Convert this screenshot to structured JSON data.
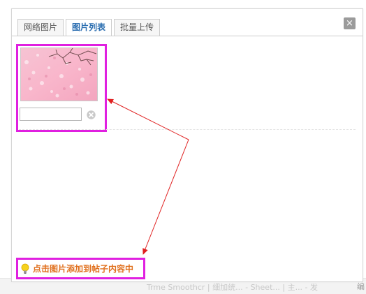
{
  "tabs": [
    {
      "label": "网络图片"
    },
    {
      "label": "图片列表"
    },
    {
      "label": "批量上传"
    }
  ],
  "active_tab": "图片列表",
  "close_label": "×",
  "images": [
    {
      "description_value": ""
    }
  ],
  "tip": {
    "text": "点击图片添加到帖子内容中",
    "icon": "lightbulb-icon"
  },
  "colors": {
    "annotation_box": "#e020e0",
    "annotation_arrow": "#e02020",
    "tip_text": "#e0701e",
    "active_tab_text": "#2a6db0"
  },
  "background_page": {
    "ghost_text": "Trme Smoothcr | 细加统... - Sheet... | 主... - 发",
    "edge_text": "编"
  }
}
